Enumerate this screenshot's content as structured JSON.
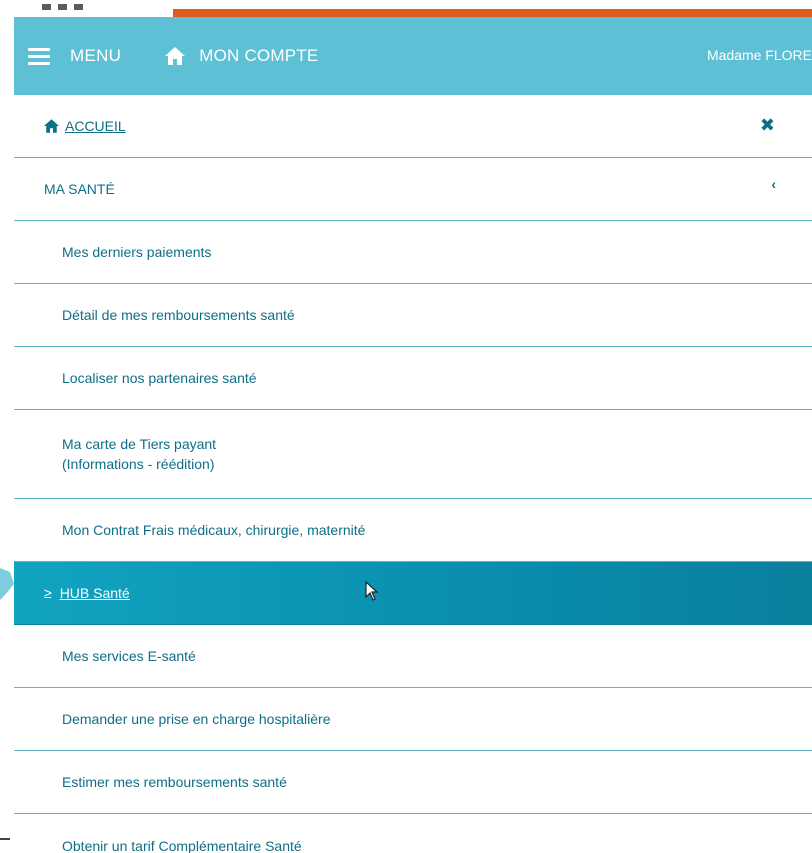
{
  "header": {
    "menu_label": "MENU",
    "account_label": "MON COMPTE",
    "user_name": "Madame FLORE",
    "accent_color": "#5ec0d4",
    "strip_color": "#dd5b1c"
  },
  "menu": {
    "home": {
      "label": "ACCUEIL",
      "icon": "home-icon",
      "close_icon": "close-icon"
    },
    "section": {
      "label": "MA SANTÉ",
      "icon": "chevron-left-icon"
    },
    "items": [
      {
        "label": "Mes derniers paiements"
      },
      {
        "label": "Détail de mes remboursements santé"
      },
      {
        "label": "Localiser nos partenaires santé"
      },
      {
        "label": "Ma carte de Tiers payant",
        "label2": "(Informations - réédition)"
      },
      {
        "label": "Mon Contrat Frais médicaux, chirurgie, maternité"
      },
      {
        "label": "HUB Santé",
        "prefix": "≥",
        "active": true
      },
      {
        "label": "Mes services E-santé"
      },
      {
        "label": "Demander une prise en charge hospitalière"
      },
      {
        "label": "Estimer mes remboursements santé"
      },
      {
        "label": "Obtenir un tarif Complémentaire Santé"
      }
    ]
  }
}
